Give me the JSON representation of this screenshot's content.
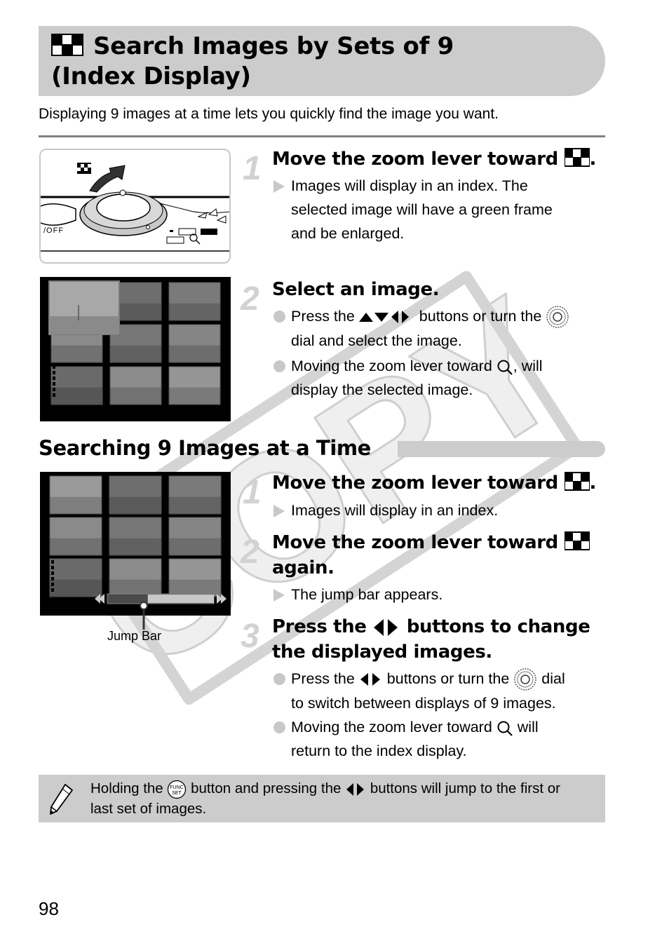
{
  "header": {
    "title_line1": "Search Images by Sets of 9",
    "title_line2": "(Index Display)",
    "title_icon": "index-display-icon"
  },
  "intro": "Displaying 9 images at a time lets you quickly find the image you want.",
  "section1": {
    "steps": [
      {
        "number": "1",
        "heading": "Move the zoom lever toward",
        "heading_suffix": ".",
        "results": [
          "Images will display in an index. The",
          "selected image will have a green frame",
          "and be enlarged."
        ]
      },
      {
        "number": "2",
        "heading": "Select an image.",
        "bullets": [
          {
            "pre": "Press the",
            "mid": "buttons or turn the",
            "post": "",
            "line2": "dial and select the image."
          },
          {
            "pre": "Moving the zoom lever toward",
            "post": ", will",
            "line2": "display the selected image."
          }
        ]
      }
    ],
    "camera_labels": {
      "off_label": "/OFF"
    }
  },
  "section2": {
    "heading": "Searching 9 Images at a Time",
    "jump_bar_label": "Jump Bar",
    "jump_bar_position": 0.38,
    "steps": [
      {
        "number": "1",
        "heading": "Move the zoom lever toward",
        "heading_suffix": ".",
        "results": [
          "Images will display in an index."
        ]
      },
      {
        "number": "2",
        "heading": "Move the zoom lever toward",
        "heading_line2": "again.",
        "results": [
          "The jump bar appears."
        ]
      },
      {
        "number": "3",
        "heading_pre": "Press the",
        "heading_post": "buttons to change",
        "heading_line2": "the displayed images.",
        "bullets": [
          {
            "pre": "Press the",
            "mid": "buttons or turn the",
            "post": "dial",
            "line2": "to switch between displays of 9 images."
          },
          {
            "pre": "Moving the zoom lever toward",
            "post": "will",
            "line2": "return to the index display."
          }
        ]
      }
    ]
  },
  "note": {
    "icon": "pencil-icon",
    "pre": "Holding the",
    "mid": "button and pressing the",
    "post": "buttons will jump to the first or",
    "line2": "last set of images.",
    "func_label_top": "FUNC",
    "func_label_bottom": "SET"
  },
  "watermark": "COPY",
  "page_number": "98"
}
